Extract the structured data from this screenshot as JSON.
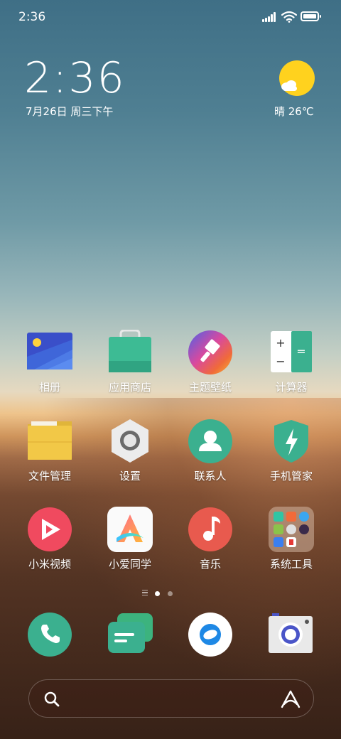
{
  "status_bar": {
    "time": "2:36"
  },
  "clock_widget": {
    "time": "2:36",
    "date": "7月26日 周三下午"
  },
  "weather_widget": {
    "text": "晴 26℃",
    "icon": "sun-cloud-icon"
  },
  "apps": [
    {
      "label": "相册",
      "icon": "gallery-icon"
    },
    {
      "label": "应用商店",
      "icon": "app-store-icon"
    },
    {
      "label": "主题壁纸",
      "icon": "themes-icon"
    },
    {
      "label": "计算器",
      "icon": "calculator-icon"
    },
    {
      "label": "文件管理",
      "icon": "file-manager-icon"
    },
    {
      "label": "设置",
      "icon": "settings-icon"
    },
    {
      "label": "联系人",
      "icon": "contacts-icon"
    },
    {
      "label": "手机管家",
      "icon": "security-icon"
    },
    {
      "label": "小米视频",
      "icon": "video-icon"
    },
    {
      "label": "小爱同学",
      "icon": "xiaoai-icon"
    },
    {
      "label": "音乐",
      "icon": "music-icon"
    },
    {
      "label": "系统工具",
      "icon": "tools-folder-icon"
    }
  ],
  "page_indicator": {
    "pages": 2,
    "current": 1
  },
  "dock": [
    {
      "name": "phone",
      "icon": "phone-icon"
    },
    {
      "name": "messages",
      "icon": "messages-icon"
    },
    {
      "name": "browser",
      "icon": "browser-icon"
    },
    {
      "name": "camera",
      "icon": "camera-icon"
    }
  ],
  "search": {
    "left_icon": "search-icon",
    "right_icon": "xiaoai-assistant-icon"
  },
  "colors": {
    "teal": "#3bb08f",
    "weather_sun": "#ffd21e",
    "video_red": "#f04a5f",
    "music_red": "#e85a4e"
  }
}
